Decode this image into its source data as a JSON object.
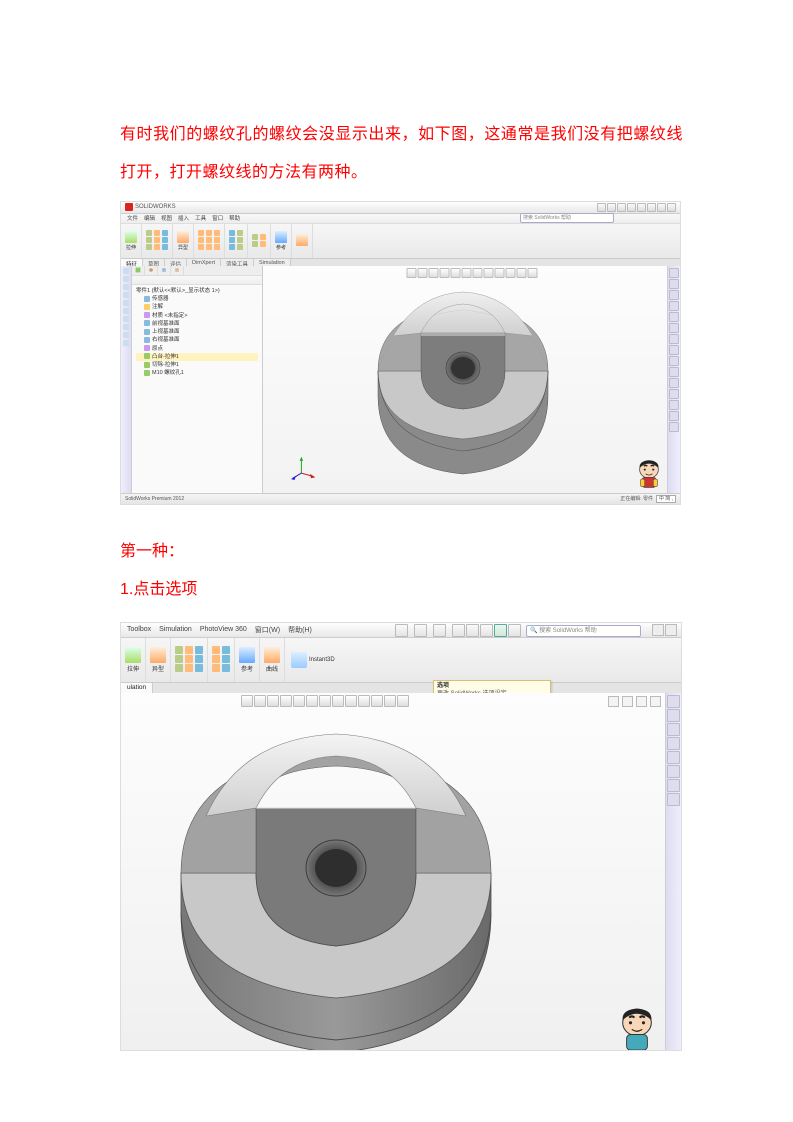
{
  "para1": "有时我们的螺纹孔的螺纹会没显示出来，如下图，这通常是我们没有把螺纹线打开，打开螺纹线的方法有两种。",
  "heading_method": "第一种：",
  "heading_step1": "1.点击选项",
  "solidworks": {
    "app_name": "SOLIDWORKS",
    "menus": [
      "文件",
      "编辑",
      "视图",
      "插入",
      "工具",
      "窗口",
      "帮助"
    ],
    "search_placeholder": "搜索 SolidWorks 帮助",
    "tabs": [
      "特征",
      "草图",
      "评估",
      "DimXpert",
      "渲染工具",
      "Simulation"
    ],
    "tree": {
      "root": "零件1 (默认<<默认>_显示状态 1>)",
      "items": [
        {
          "icon": "b",
          "label": "传感器",
          "indent": 0
        },
        {
          "icon": "y",
          "label": "注解",
          "indent": 0
        },
        {
          "icon": "p",
          "label": "材质 <未指定>",
          "indent": 0
        },
        {
          "icon": "b",
          "label": "前视基准面",
          "indent": 0
        },
        {
          "icon": "b",
          "label": "上视基准面",
          "indent": 0
        },
        {
          "icon": "b",
          "label": "右视基准面",
          "indent": 0
        },
        {
          "icon": "p",
          "label": "原点",
          "indent": 0
        },
        {
          "icon": "",
          "label": "凸台-拉伸1",
          "indent": 0,
          "hi": true
        },
        {
          "icon": "",
          "label": "切除-拉伸1",
          "indent": 0
        },
        {
          "icon": "",
          "label": "M10 螺纹孔1",
          "indent": 0
        }
      ]
    },
    "status_left": "SolidWorks Premium 2012",
    "status_right": "正在编辑: 零件",
    "lang_badge": "中 简 ,"
  },
  "screenshot2": {
    "top_menu": [
      "Toolbox",
      "Simulation",
      "PhotoView 360",
      "窗口(W)",
      "帮助(H)"
    ],
    "search_placeholder": "搜索 SolidWorks 帮助",
    "instant3d": "Instant3D",
    "tab": "ulation",
    "tooltip_title": "选项",
    "tooltip_body": "更改 SolidWorks 选项设定。",
    "tr_label": "图 口 — 印"
  }
}
